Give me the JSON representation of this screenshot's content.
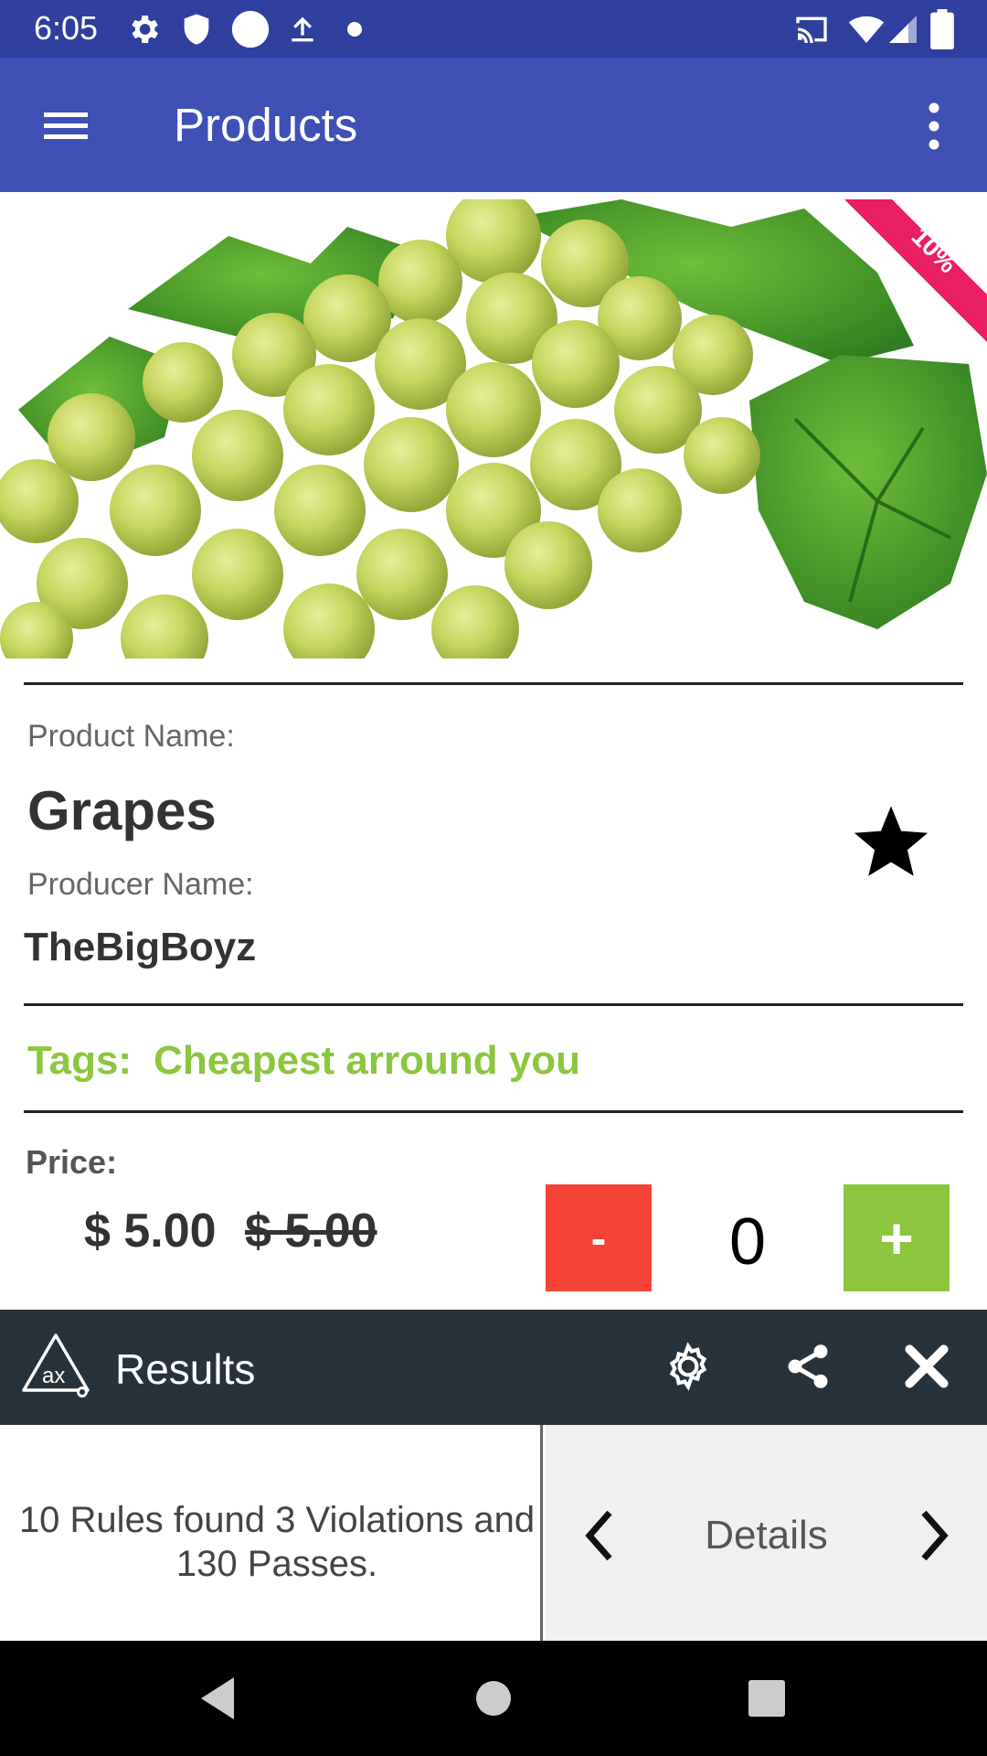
{
  "status_bar": {
    "time": "6:05",
    "icons": [
      "settings-icon",
      "shield-icon",
      "circle-icon",
      "upload-icon",
      "dot-icon",
      "cast-icon",
      "wifi-icon",
      "signal-icon",
      "battery-icon"
    ]
  },
  "app_bar": {
    "title": "Products",
    "menu_icon": "hamburger-menu-icon",
    "overflow_icon": "more-vert-icon"
  },
  "product": {
    "image": "grapes-photo",
    "discount": "10%",
    "name_label": "Product Name:",
    "name": "Grapes",
    "producer_label": "Producer Name:",
    "producer": "TheBigBoyz",
    "favorite_icon": "star-icon",
    "tags_label": "Tags:",
    "tags_value": "Cheapest arround you",
    "price_label": "Price:",
    "price_current": "$ 5.00",
    "price_original": "$ 5.00",
    "minus_label": "-",
    "quantity": "0",
    "plus_label": "+"
  },
  "results": {
    "title": "Results",
    "logo": "ax-logo-icon",
    "summary": "10 Rules found 3 Violations and 130 Passes.",
    "details_label": "Details"
  },
  "colors": {
    "status_bar": "#2f3f9e",
    "app_bar": "#3f51b5",
    "ribbon": "#e91e63",
    "tags": "#8cc63f",
    "minus_button": "#f44336",
    "plus_button": "#8cc63f",
    "results_bar": "#28323b"
  }
}
